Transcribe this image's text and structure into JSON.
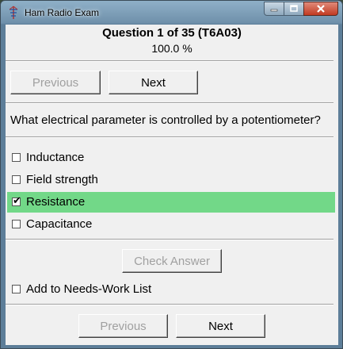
{
  "window": {
    "title": "Ham Radio Exam"
  },
  "header": {
    "question_title": "Question 1 of 35 (T6A03)",
    "percent": "100.0 %"
  },
  "nav_top": {
    "previous_label": "Previous",
    "next_label": "Next"
  },
  "question": {
    "text": "What electrical parameter is controlled by a potentiometer?"
  },
  "options": [
    {
      "label": "Inductance",
      "checked": false
    },
    {
      "label": "Field strength",
      "checked": false
    },
    {
      "label": "Resistance",
      "checked": true
    },
    {
      "label": "Capacitance",
      "checked": false
    }
  ],
  "check_answer": {
    "label": "Check Answer"
  },
  "needs_work": {
    "label": "Add to Needs-Work List",
    "checked": false
  },
  "nav_bottom": {
    "previous_label": "Previous",
    "next_label": "Next"
  },
  "colors": {
    "selected_row": "#72d888",
    "disabled_text": "#a0a0a0"
  }
}
